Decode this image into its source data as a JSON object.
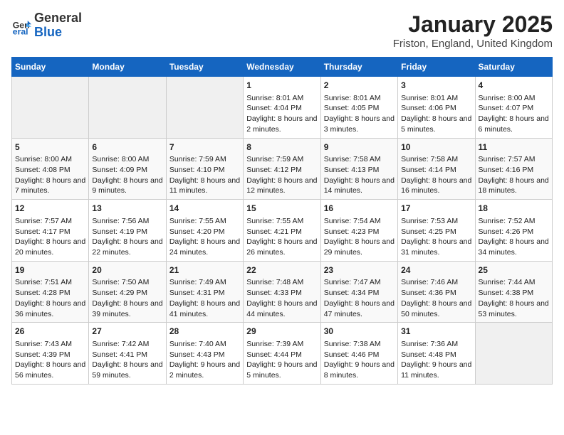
{
  "header": {
    "logo_general": "General",
    "logo_blue": "Blue",
    "title": "January 2025",
    "subtitle": "Friston, England, United Kingdom"
  },
  "days_of_week": [
    "Sunday",
    "Monday",
    "Tuesday",
    "Wednesday",
    "Thursday",
    "Friday",
    "Saturday"
  ],
  "weeks": [
    [
      {
        "day": "",
        "info": ""
      },
      {
        "day": "",
        "info": ""
      },
      {
        "day": "",
        "info": ""
      },
      {
        "day": "1",
        "info": "Sunrise: 8:01 AM\nSunset: 4:04 PM\nDaylight: 8 hours and 2 minutes."
      },
      {
        "day": "2",
        "info": "Sunrise: 8:01 AM\nSunset: 4:05 PM\nDaylight: 8 hours and 3 minutes."
      },
      {
        "day": "3",
        "info": "Sunrise: 8:01 AM\nSunset: 4:06 PM\nDaylight: 8 hours and 5 minutes."
      },
      {
        "day": "4",
        "info": "Sunrise: 8:00 AM\nSunset: 4:07 PM\nDaylight: 8 hours and 6 minutes."
      }
    ],
    [
      {
        "day": "5",
        "info": "Sunrise: 8:00 AM\nSunset: 4:08 PM\nDaylight: 8 hours and 7 minutes."
      },
      {
        "day": "6",
        "info": "Sunrise: 8:00 AM\nSunset: 4:09 PM\nDaylight: 8 hours and 9 minutes."
      },
      {
        "day": "7",
        "info": "Sunrise: 7:59 AM\nSunset: 4:10 PM\nDaylight: 8 hours and 11 minutes."
      },
      {
        "day": "8",
        "info": "Sunrise: 7:59 AM\nSunset: 4:12 PM\nDaylight: 8 hours and 12 minutes."
      },
      {
        "day": "9",
        "info": "Sunrise: 7:58 AM\nSunset: 4:13 PM\nDaylight: 8 hours and 14 minutes."
      },
      {
        "day": "10",
        "info": "Sunrise: 7:58 AM\nSunset: 4:14 PM\nDaylight: 8 hours and 16 minutes."
      },
      {
        "day": "11",
        "info": "Sunrise: 7:57 AM\nSunset: 4:16 PM\nDaylight: 8 hours and 18 minutes."
      }
    ],
    [
      {
        "day": "12",
        "info": "Sunrise: 7:57 AM\nSunset: 4:17 PM\nDaylight: 8 hours and 20 minutes."
      },
      {
        "day": "13",
        "info": "Sunrise: 7:56 AM\nSunset: 4:19 PM\nDaylight: 8 hours and 22 minutes."
      },
      {
        "day": "14",
        "info": "Sunrise: 7:55 AM\nSunset: 4:20 PM\nDaylight: 8 hours and 24 minutes."
      },
      {
        "day": "15",
        "info": "Sunrise: 7:55 AM\nSunset: 4:21 PM\nDaylight: 8 hours and 26 minutes."
      },
      {
        "day": "16",
        "info": "Sunrise: 7:54 AM\nSunset: 4:23 PM\nDaylight: 8 hours and 29 minutes."
      },
      {
        "day": "17",
        "info": "Sunrise: 7:53 AM\nSunset: 4:25 PM\nDaylight: 8 hours and 31 minutes."
      },
      {
        "day": "18",
        "info": "Sunrise: 7:52 AM\nSunset: 4:26 PM\nDaylight: 8 hours and 34 minutes."
      }
    ],
    [
      {
        "day": "19",
        "info": "Sunrise: 7:51 AM\nSunset: 4:28 PM\nDaylight: 8 hours and 36 minutes."
      },
      {
        "day": "20",
        "info": "Sunrise: 7:50 AM\nSunset: 4:29 PM\nDaylight: 8 hours and 39 minutes."
      },
      {
        "day": "21",
        "info": "Sunrise: 7:49 AM\nSunset: 4:31 PM\nDaylight: 8 hours and 41 minutes."
      },
      {
        "day": "22",
        "info": "Sunrise: 7:48 AM\nSunset: 4:33 PM\nDaylight: 8 hours and 44 minutes."
      },
      {
        "day": "23",
        "info": "Sunrise: 7:47 AM\nSunset: 4:34 PM\nDaylight: 8 hours and 47 minutes."
      },
      {
        "day": "24",
        "info": "Sunrise: 7:46 AM\nSunset: 4:36 PM\nDaylight: 8 hours and 50 minutes."
      },
      {
        "day": "25",
        "info": "Sunrise: 7:44 AM\nSunset: 4:38 PM\nDaylight: 8 hours and 53 minutes."
      }
    ],
    [
      {
        "day": "26",
        "info": "Sunrise: 7:43 AM\nSunset: 4:39 PM\nDaylight: 8 hours and 56 minutes."
      },
      {
        "day": "27",
        "info": "Sunrise: 7:42 AM\nSunset: 4:41 PM\nDaylight: 8 hours and 59 minutes."
      },
      {
        "day": "28",
        "info": "Sunrise: 7:40 AM\nSunset: 4:43 PM\nDaylight: 9 hours and 2 minutes."
      },
      {
        "day": "29",
        "info": "Sunrise: 7:39 AM\nSunset: 4:44 PM\nDaylight: 9 hours and 5 minutes."
      },
      {
        "day": "30",
        "info": "Sunrise: 7:38 AM\nSunset: 4:46 PM\nDaylight: 9 hours and 8 minutes."
      },
      {
        "day": "31",
        "info": "Sunrise: 7:36 AM\nSunset: 4:48 PM\nDaylight: 9 hours and 11 minutes."
      },
      {
        "day": "",
        "info": ""
      }
    ]
  ]
}
